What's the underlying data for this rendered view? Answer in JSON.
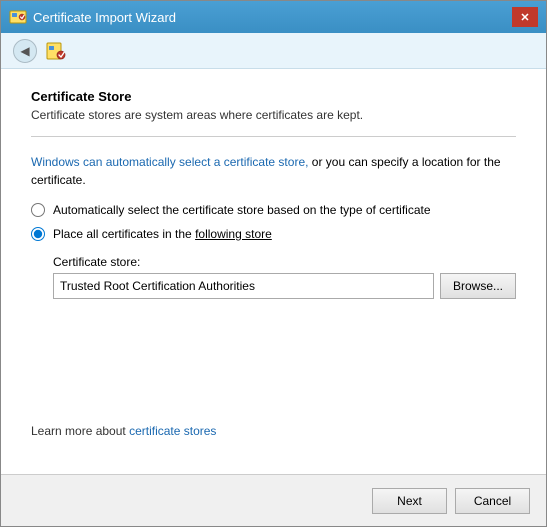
{
  "window": {
    "title": "Certificate Import Wizard",
    "close_label": "✕"
  },
  "nav": {
    "back_label": "◀"
  },
  "content": {
    "section_title": "Certificate Store",
    "section_desc": "Certificate stores are system areas where certificates are kept.",
    "info_text_part1": "Windows can automatically select a certificate store, ",
    "info_text_part2": "or you can specify a location for the certificate.",
    "radio_auto_label": "Automatically select the certificate store based on the type of certificate",
    "radio_place_label_prefix": "Place all certificates in the ",
    "radio_place_label_underline": "following store",
    "cert_store_label": "Certificate store:",
    "cert_store_value": "Trusted Root Certification Authorities",
    "browse_label": "Browse...",
    "learn_more_prefix": "Learn more about ",
    "learn_more_link": "certificate stores"
  },
  "footer": {
    "next_label": "Next",
    "cancel_label": "Cancel"
  }
}
